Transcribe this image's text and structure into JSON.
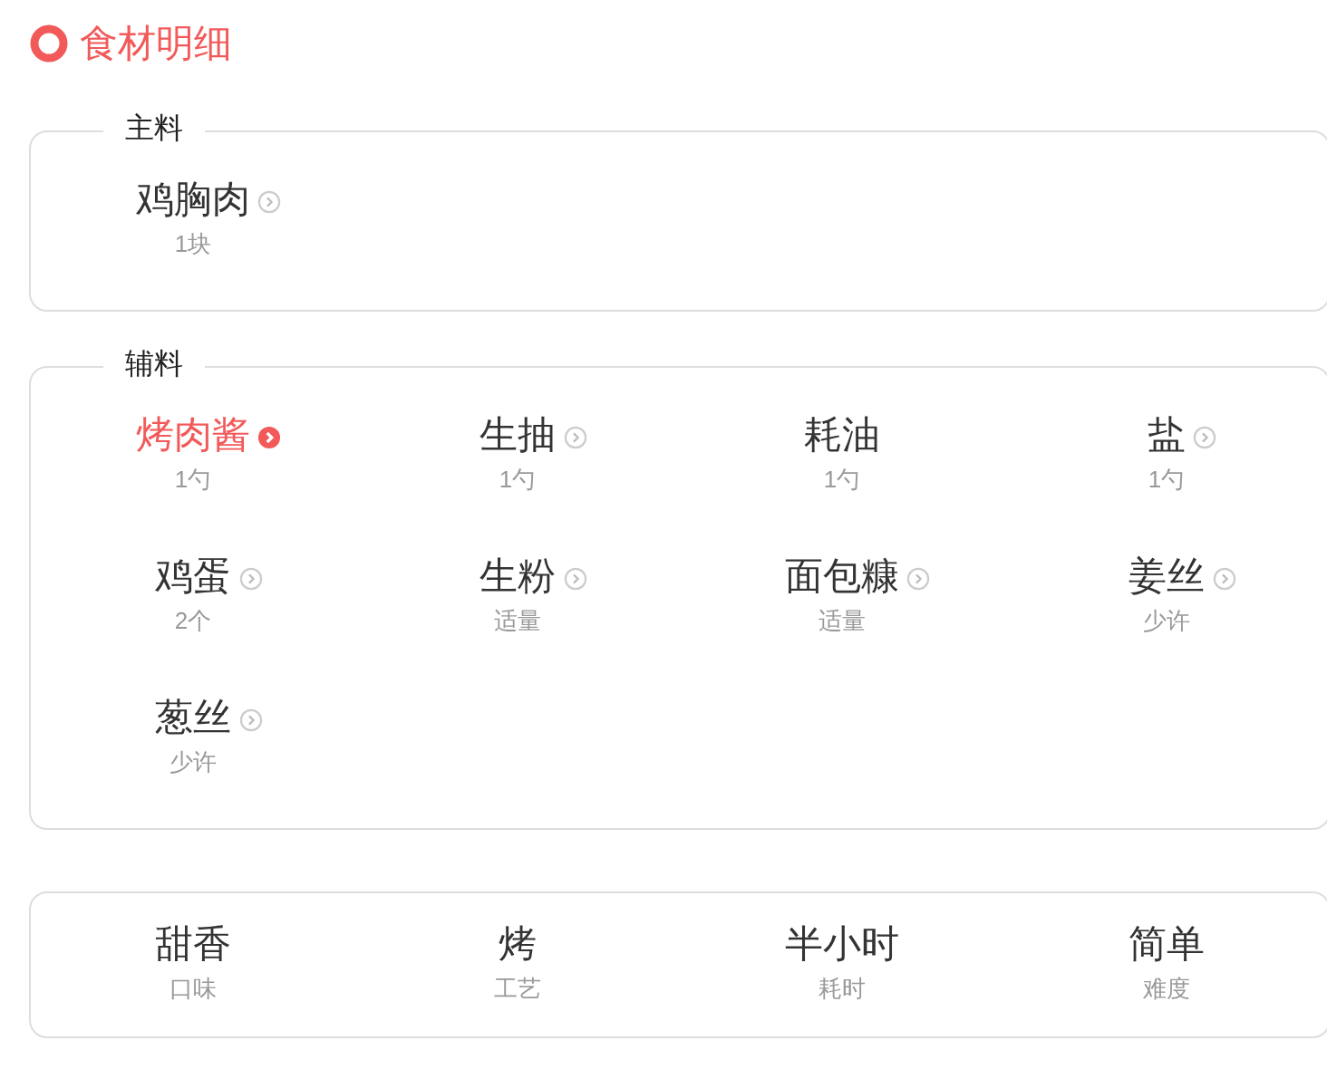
{
  "section_title": "食材明细",
  "groups": [
    {
      "legend": "主料",
      "items": [
        {
          "name": "鸡胸肉",
          "amount": "1块",
          "linked": true,
          "highlighted": false
        }
      ]
    },
    {
      "legend": "辅料",
      "items": [
        {
          "name": "烤肉酱",
          "amount": "1勺",
          "linked": true,
          "highlighted": true
        },
        {
          "name": "生抽",
          "amount": "1勺",
          "linked": true,
          "highlighted": false
        },
        {
          "name": "耗油",
          "amount": "1勺",
          "linked": false,
          "highlighted": false
        },
        {
          "name": "盐",
          "amount": "1勺",
          "linked": true,
          "highlighted": false
        },
        {
          "name": "鸡蛋",
          "amount": "2个",
          "linked": true,
          "highlighted": false
        },
        {
          "name": "生粉",
          "amount": "适量",
          "linked": true,
          "highlighted": false
        },
        {
          "name": "面包糠",
          "amount": "适量",
          "linked": true,
          "highlighted": false
        },
        {
          "name": "姜丝",
          "amount": "少许",
          "linked": true,
          "highlighted": false
        },
        {
          "name": "葱丝",
          "amount": "少许",
          "linked": true,
          "highlighted": false
        }
      ]
    }
  ],
  "summary": [
    {
      "value": "甜香",
      "label": "口味"
    },
    {
      "value": "烤",
      "label": "工艺"
    },
    {
      "value": "半小时",
      "label": "耗时"
    },
    {
      "value": "简单",
      "label": "难度"
    }
  ]
}
